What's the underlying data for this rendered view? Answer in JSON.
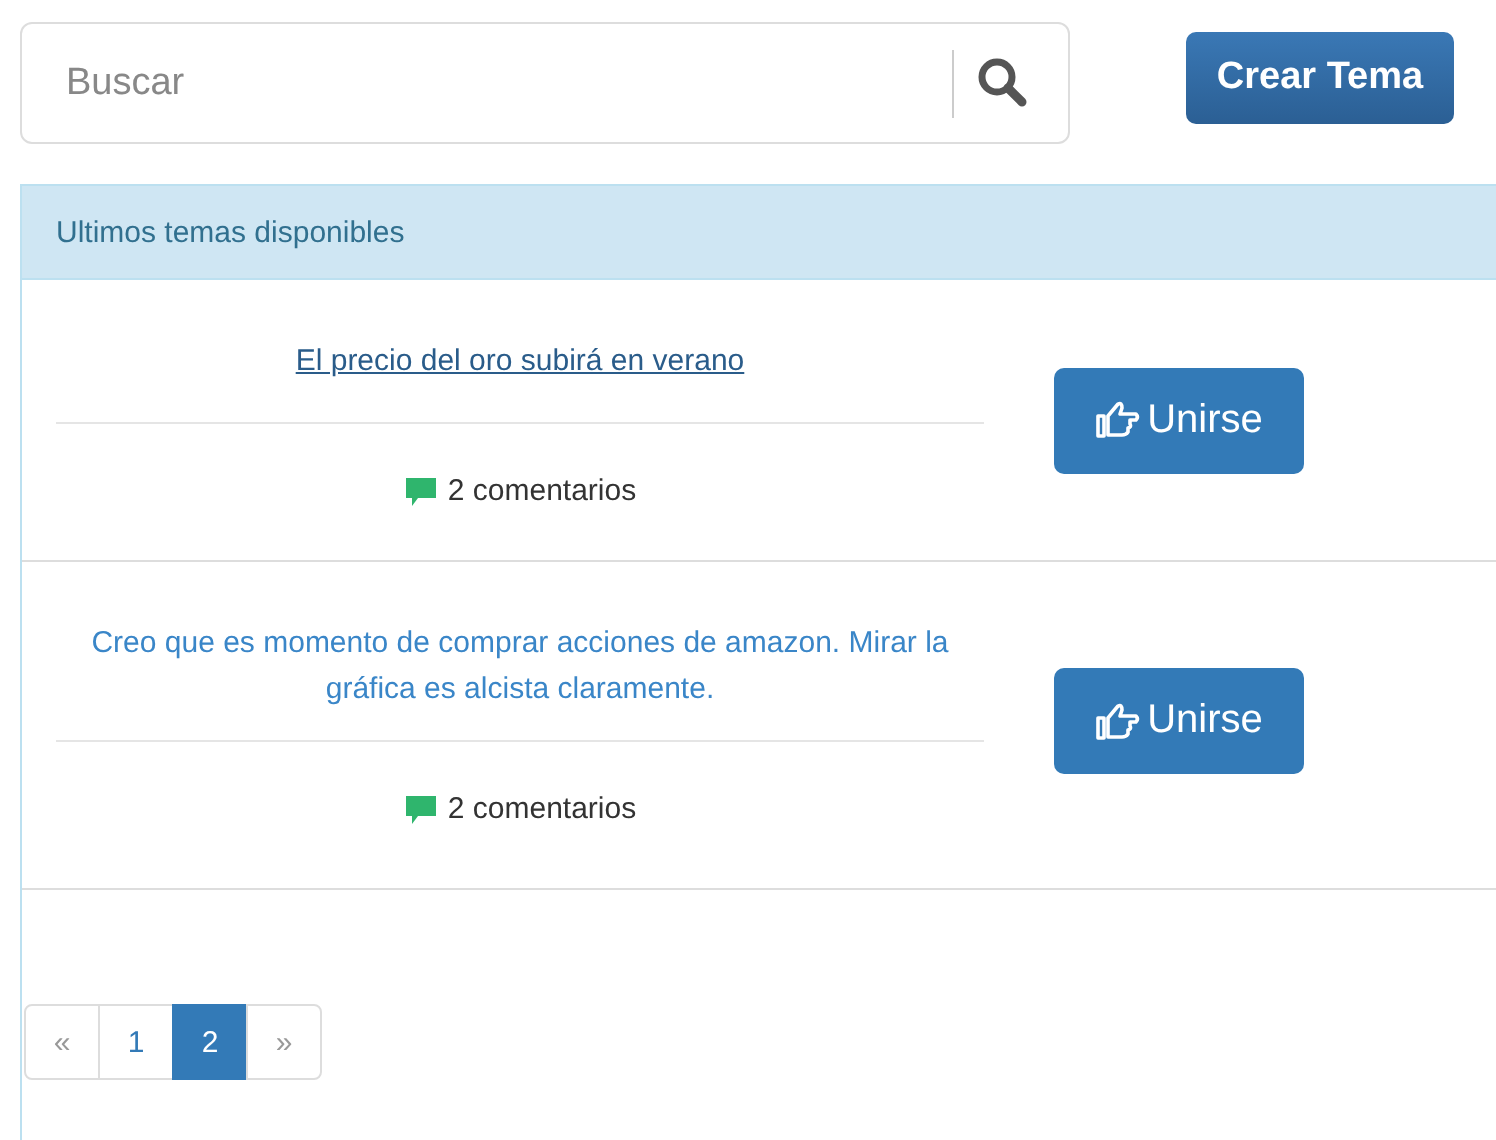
{
  "search": {
    "placeholder": "Buscar"
  },
  "create_button": "Crear Tema",
  "panel": {
    "title": "Ultimos temas disponibles"
  },
  "topics": [
    {
      "title": "El precio del oro subirá en verano",
      "hovered": true,
      "comments": "2 comentarios",
      "join_button": "Unirse"
    },
    {
      "title": "Creo que es momento de comprar acciones de amazon. Mirar la gráfica es alcista claramente.",
      "hovered": false,
      "comments": "2 comentarios",
      "join_button": "Unirse"
    }
  ],
  "pagination": [
    {
      "label": "«",
      "selected": false,
      "disabled": true
    },
    {
      "label": "1",
      "selected": false,
      "disabled": false
    },
    {
      "label": "2",
      "selected": true,
      "disabled": false
    },
    {
      "label": "»",
      "selected": false,
      "disabled": true
    }
  ]
}
